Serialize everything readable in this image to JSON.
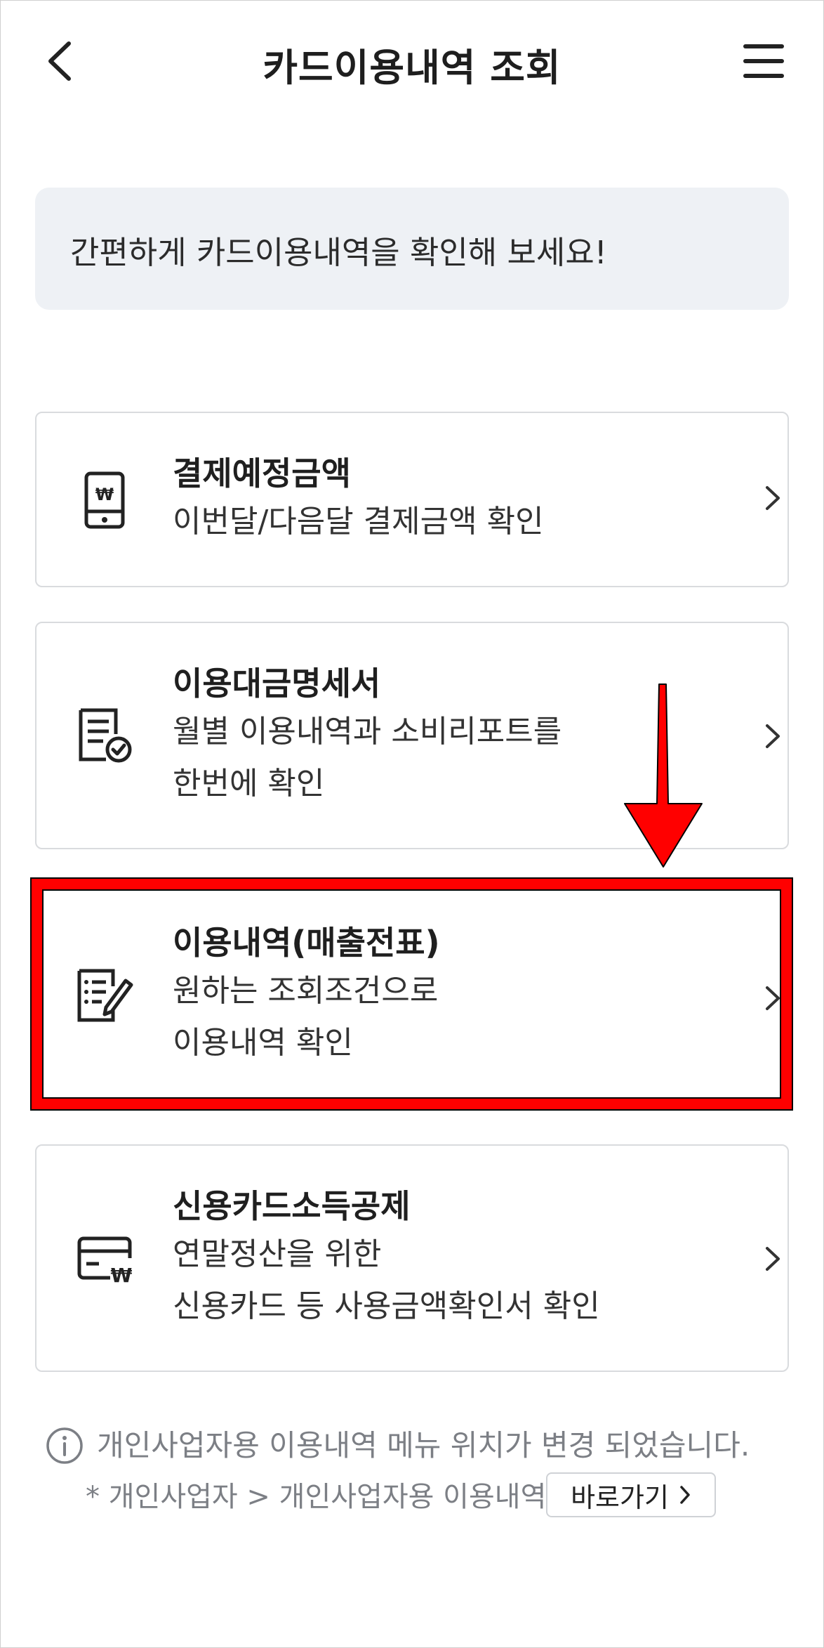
{
  "header": {
    "title": "카드이용내역 조회"
  },
  "notice": {
    "text": "간편하게 카드이용내역을 확인해 보세요!"
  },
  "menu": [
    {
      "title": "결제예정금액",
      "desc": "이번달/다음달 결제금액 확인",
      "icon": "card-payment-won-icon"
    },
    {
      "title": "이용대금명세서",
      "desc": "월별 이용내역과 소비리포트를\n한번에 확인",
      "icon": "statement-check-icon"
    },
    {
      "title": "이용내역(매출전표)",
      "desc": "원하는 조회조건으로\n이용내역 확인",
      "icon": "receipt-edit-icon"
    },
    {
      "title": "신용카드소득공제",
      "desc": "연말정산을 위한\n신용카드 등 사용금액확인서 확인",
      "icon": "credit-card-won-icon"
    }
  ],
  "footer": {
    "info_text": "개인사업자용 이용내역 메뉴 위치가 변경 되었습니다.",
    "path_text": "* 개인사업자 > 개인사업자용 이용내역",
    "shortcut_label": "바로가기"
  },
  "annotation": {
    "highlight_color": "#ff0000",
    "highlighted_item": "이용내역(매출전표)"
  }
}
